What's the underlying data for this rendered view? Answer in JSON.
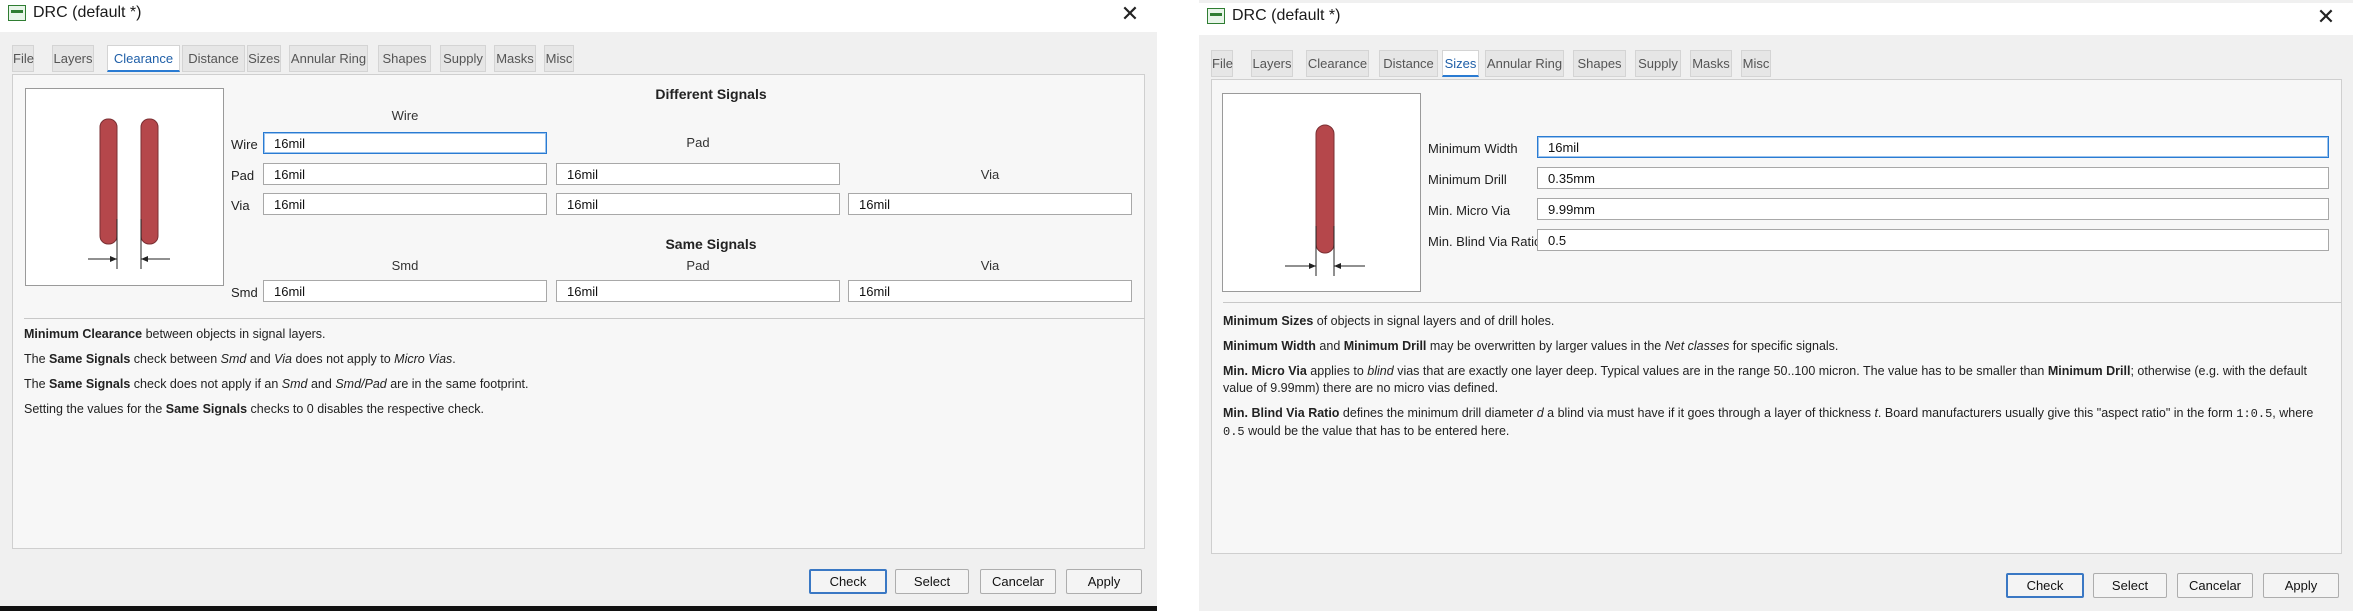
{
  "left": {
    "title": "DRC (default *)",
    "tabs": [
      "File",
      "Layers",
      "Clearance",
      "Distance",
      "Sizes",
      "Annular Ring",
      "Shapes",
      "Supply",
      "Masks",
      "Misc"
    ],
    "active_tab": "Clearance",
    "different_signals": {
      "heading": "Different Signals",
      "col_wire": "Wire",
      "col_pad": "Pad",
      "col_via": "Via",
      "row_wire": "Wire",
      "row_pad": "Pad",
      "row_via": "Via",
      "wire_wire": "16mil",
      "pad_wire": "16mil",
      "pad_pad": "16mil",
      "via_wire": "16mil",
      "via_pad": "16mil",
      "via_via": "16mil"
    },
    "same_signals": {
      "heading": "Same Signals",
      "col_smd": "Smd",
      "col_pad": "Pad",
      "col_via": "Via",
      "row_smd": "Smd",
      "smd_smd": "16mil",
      "smd_pad": "16mil",
      "smd_via": "16mil"
    },
    "desc": {
      "p1_b": "Minimum Clearance",
      "p1_t": " between objects in signal layers.",
      "p2_a": "The ",
      "p2_b": "Same Signals",
      "p2_c": " check between ",
      "p2_i1": "Smd",
      "p2_d": " and ",
      "p2_i2": "Via",
      "p2_e": " does not apply to ",
      "p2_i3": "Micro Vias",
      "p2_f": ".",
      "p3_a": "The ",
      "p3_b": "Same Signals",
      "p3_c": " check does not apply if an ",
      "p3_i1": "Smd",
      "p3_d": " and ",
      "p3_i2": "Smd/Pad",
      "p3_e": " are in the same footprint.",
      "p4_a": "Setting the values for the ",
      "p4_b": "Same Signals",
      "p4_c": " checks to 0 disables the respective check."
    },
    "buttons": {
      "check": "Check",
      "select": "Select",
      "cancel": "Cancelar",
      "apply": "Apply"
    }
  },
  "right": {
    "title": "DRC (default *)",
    "tabs": [
      "File",
      "Layers",
      "Clearance",
      "Distance",
      "Sizes",
      "Annular Ring",
      "Shapes",
      "Supply",
      "Masks",
      "Misc"
    ],
    "active_tab": "Sizes",
    "fields": {
      "min_width_label": "Minimum Width",
      "min_width": "16mil",
      "min_drill_label": "Minimum Drill",
      "min_drill": "0.35mm",
      "min_micro_via_label": "Min. Micro Via",
      "min_micro_via": "9.99mm",
      "min_blind_label": "Min. Blind Via Ratio",
      "min_blind": "0.5"
    },
    "desc": {
      "p1_b": "Minimum Sizes",
      "p1_t": " of objects in signal layers and of drill holes.",
      "p2_b1": "Minimum Width",
      "p2_a": " and ",
      "p2_b2": "Minimum Drill",
      "p2_c": " may be overwritten by larger values in the ",
      "p2_i": "Net classes",
      "p2_d": " for specific signals.",
      "p3_b": "Min. Micro Via",
      "p3_a": " applies to ",
      "p3_i": "blind",
      "p3_c": " vias that are exactly one layer deep. Typical values are in the range 50..100 micron. The value has to be smaller than ",
      "p3_b2": "Minimum Drill",
      "p3_d": "; otherwise (e.g. with the default",
      "p3_line2": "value of 9.99mm) there are no micro vias defined.",
      "p4_b": "Min. Blind Via Ratio",
      "p4_a": " defines the minimum drill diameter ",
      "p4_i1": "d",
      "p4_c": " a blind via must have if it goes through a layer of thickness ",
      "p4_i2": "t",
      "p4_d": ". Board manufacturers usually give this \"aspect ratio\" in the form ",
      "p4_m1": "1:0.5",
      "p4_e": ", where",
      "p4_m2": "0.5",
      "p4_f": " would be the value that has to be entered here."
    },
    "buttons": {
      "check": "Check",
      "select": "Select",
      "cancel": "Cancelar",
      "apply": "Apply"
    }
  },
  "colors": {
    "accent": "#2a7bd2",
    "trace": "#b5474b",
    "window_bg": "#f0f0f0"
  },
  "icons": {
    "app": "drc-app-icon",
    "close": "close-icon"
  }
}
